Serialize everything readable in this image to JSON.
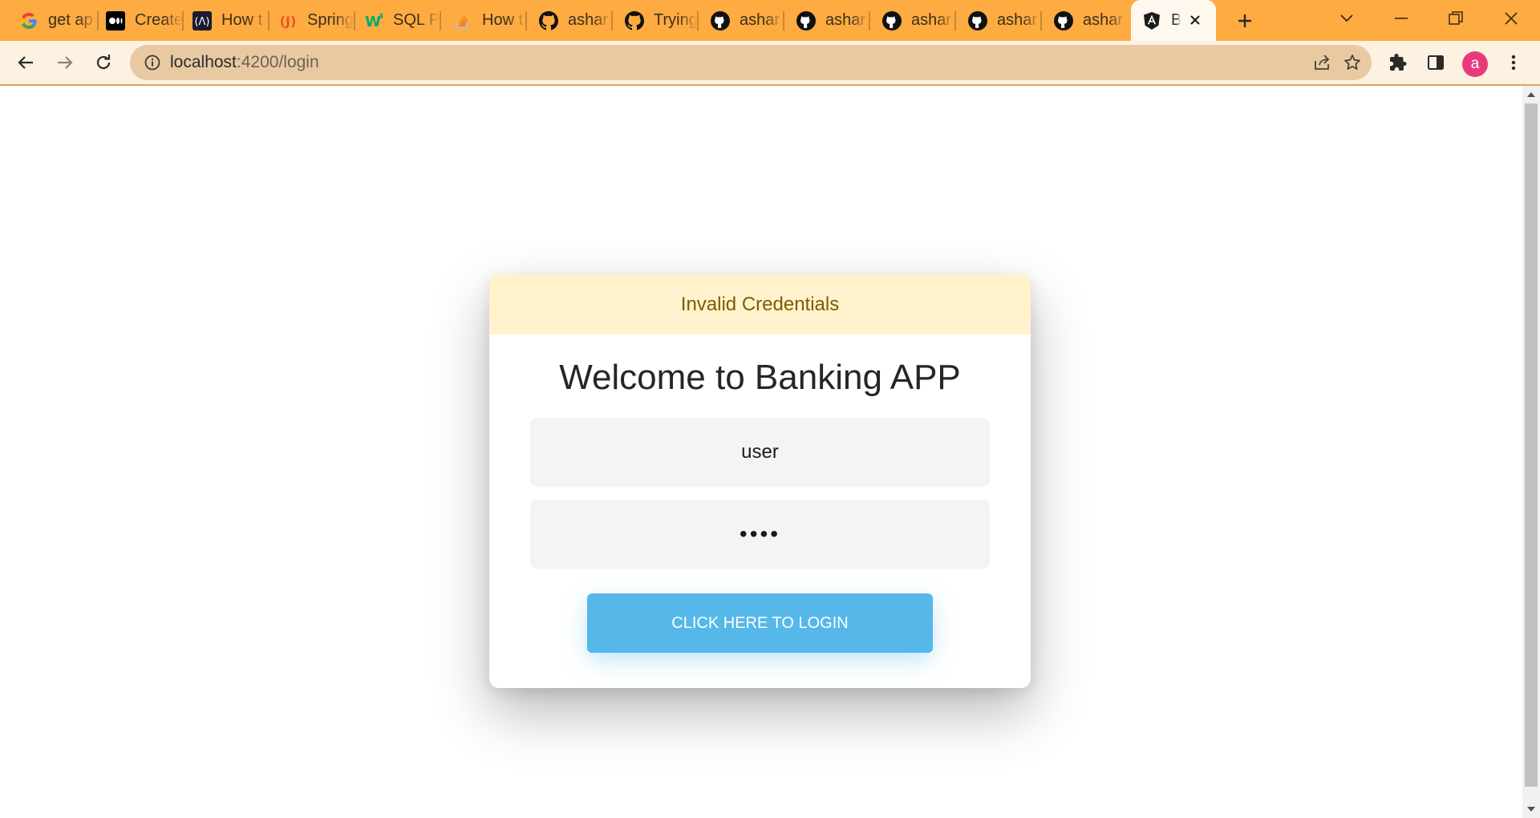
{
  "browser": {
    "tabs": [
      {
        "title": "get ap",
        "icon": "google-icon"
      },
      {
        "title": "Create",
        "icon": "medium-icon"
      },
      {
        "title": "How t",
        "icon": "angular-dark-icon"
      },
      {
        "title": "Spring",
        "icon": "javatpoint-icon"
      },
      {
        "title": "SQL P",
        "icon": "w3schools-icon"
      },
      {
        "title": "How t",
        "icon": "stackoverflow-icon"
      },
      {
        "title": "ashar",
        "icon": "github-icon"
      },
      {
        "title": "Trying",
        "icon": "github-icon"
      },
      {
        "title": "ashar",
        "icon": "github-icon"
      },
      {
        "title": "ashar",
        "icon": "github-icon"
      },
      {
        "title": "ashar",
        "icon": "github-icon"
      },
      {
        "title": "ashar",
        "icon": "github-icon"
      },
      {
        "title": "ashar",
        "icon": "github-icon"
      }
    ],
    "active_tab": {
      "title": "Ba",
      "icon": "angular-icon"
    },
    "url": {
      "host": "localhost",
      "path": ":4200/login"
    },
    "profile_initial": "a",
    "colors": {
      "tabstrip": "#feab42",
      "toolbar": "#fdf1e2",
      "omnibox": "#e8c9a2",
      "avatar": "#e93b7b"
    }
  },
  "login": {
    "alert": "Invalid Credentials",
    "heading": "Welcome to Banking APP",
    "username_value": "user",
    "password_value": "test",
    "button_label": "CLICK HERE TO LOGIN",
    "colors": {
      "alert_bg": "#fff2cc",
      "alert_text": "#7a5d05",
      "button": "#56b7e9"
    }
  }
}
